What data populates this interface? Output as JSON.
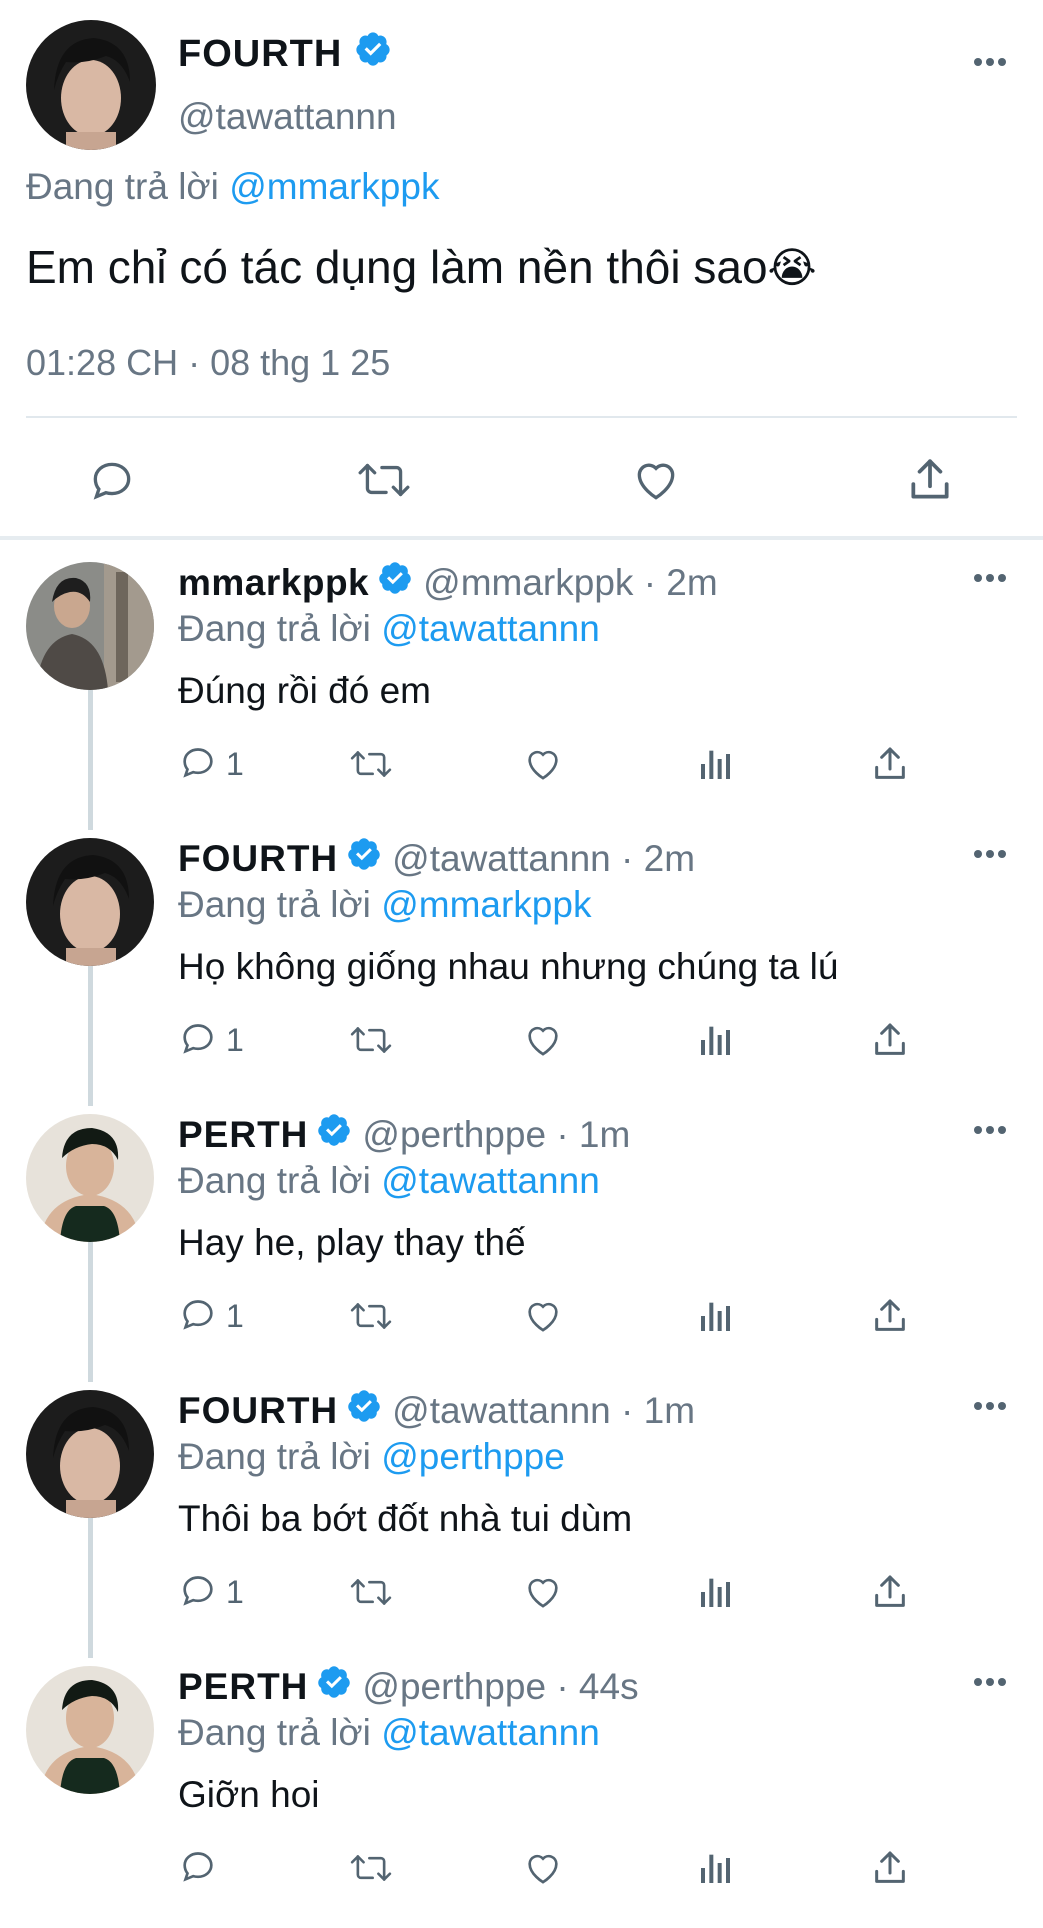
{
  "main": {
    "name": "FOURTH",
    "handle": "@tawattannn",
    "replying_prefix": "Đang trả lời",
    "replying_to": "@mmarkppk",
    "text": "Em chỉ có tác dụng làm nền thôi sao",
    "emoji": "😭",
    "timestamp": "01:28 CH · 08 thg 1 25"
  },
  "replies": [
    {
      "name": "mmarkppk",
      "handle": "@mmarkppk",
      "time": "· 2m",
      "replying_prefix": "Đang trả lời",
      "replying_to": "@tawattannn",
      "text": "Đúng rồi đó em",
      "reply_count": "1"
    },
    {
      "name": "FOURTH",
      "handle": "@tawattannn",
      "time": "· 2m",
      "replying_prefix": "Đang trả lời",
      "replying_to": "@mmarkppk",
      "text": "Họ không giống nhau nhưng chúng ta lú",
      "reply_count": "1"
    },
    {
      "name": "PERTH",
      "handle": "@perthppe",
      "time": "· 1m",
      "replying_prefix": "Đang trả lời",
      "replying_to": "@tawattannn",
      "text": "Hay he, play thay thế",
      "reply_count": "1"
    },
    {
      "name": "FOURTH",
      "handle": "@tawattannn",
      "time": "· 1m",
      "replying_prefix": "Đang trả lời",
      "replying_to": "@perthppe",
      "text": "Thôi ba bớt đốt nhà tui dùm",
      "reply_count": "1"
    },
    {
      "name": "PERTH",
      "handle": "@perthppe",
      "time": "· 44s",
      "replying_prefix": "Đang trả lời",
      "replying_to": "@tawattannn",
      "text": "Giỡn hoi",
      "reply_count": ""
    }
  ],
  "colors": {
    "link": "#1d9bf0",
    "muted": "#687684",
    "verified": "#1d9bf0",
    "divider": "#e6ecf0"
  },
  "icons": [
    "reply-icon",
    "retweet-icon",
    "like-icon",
    "views-icon",
    "share-icon",
    "more-icon",
    "verified-badge"
  ]
}
